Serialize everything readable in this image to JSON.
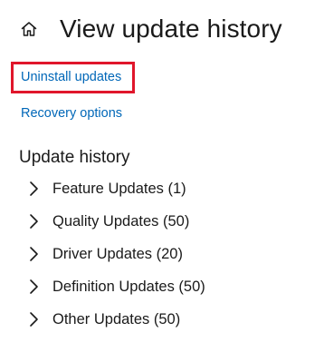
{
  "header": {
    "home_icon": "home-icon",
    "title": "View update history"
  },
  "links": {
    "uninstall": "Uninstall updates",
    "recovery": "Recovery options"
  },
  "highlight_color": "#e0162b",
  "link_color": "#0067b8",
  "update_history": {
    "title": "Update history",
    "items": [
      {
        "label": "Feature Updates (1)",
        "icon": "chevron-right-icon"
      },
      {
        "label": "Quality Updates (50)",
        "icon": "chevron-right-icon"
      },
      {
        "label": "Driver Updates (20)",
        "icon": "chevron-right-icon"
      },
      {
        "label": "Definition Updates (50)",
        "icon": "chevron-right-icon"
      },
      {
        "label": "Other Updates (50)",
        "icon": "chevron-right-icon"
      }
    ]
  }
}
